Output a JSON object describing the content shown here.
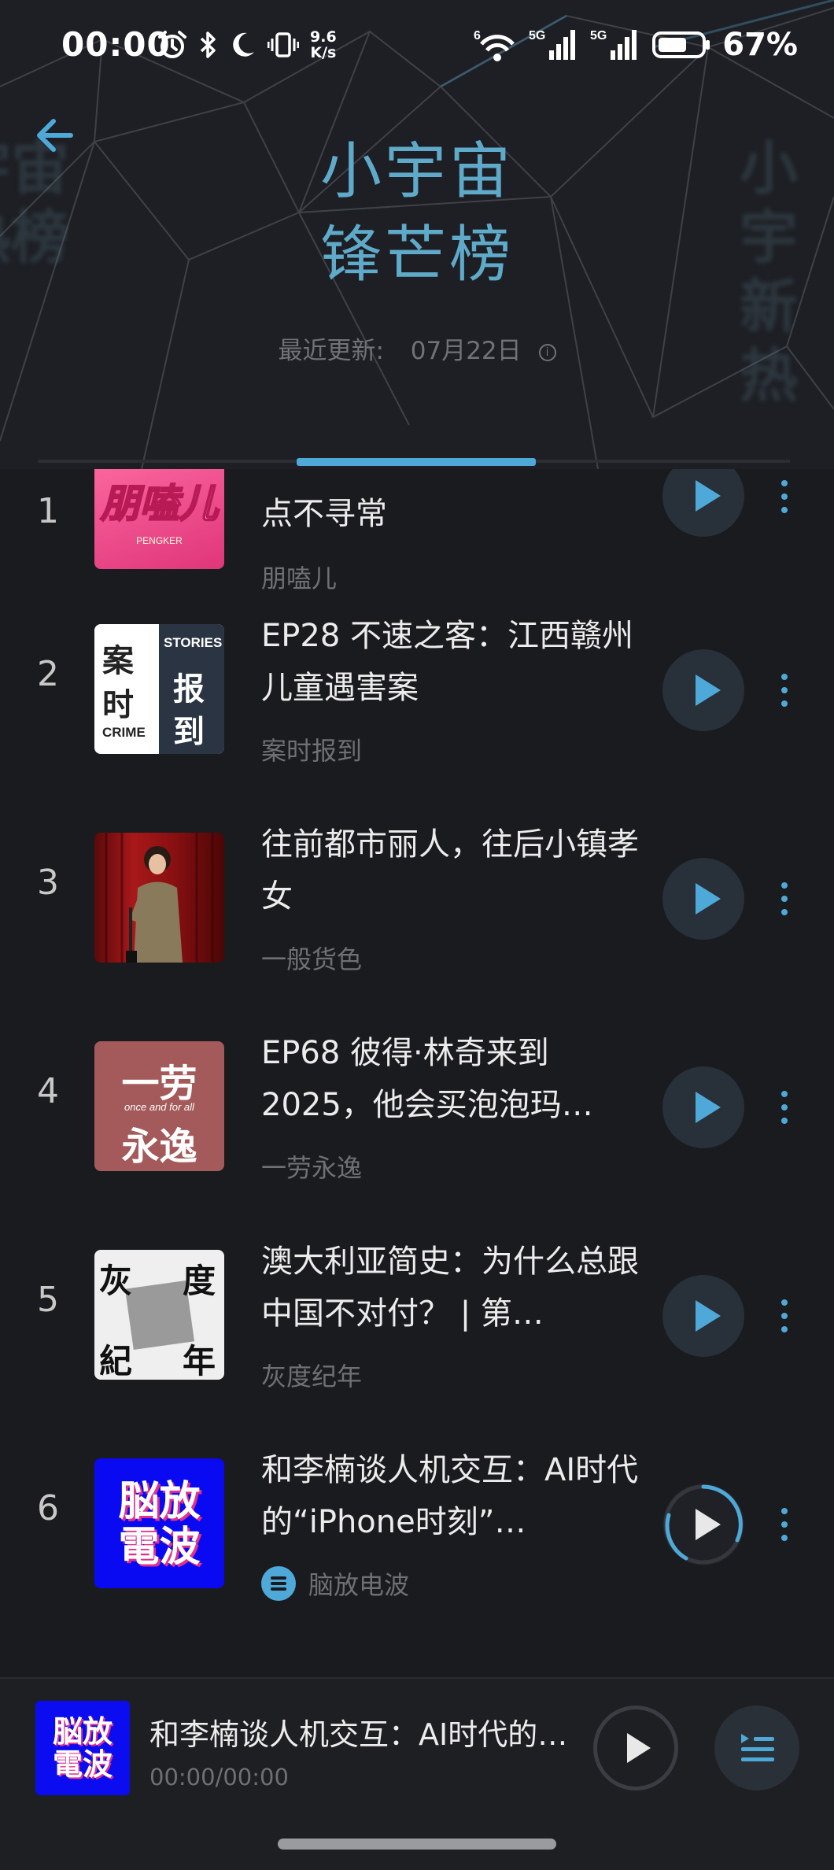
{
  "status": {
    "time": "00:00",
    "net_speed_value": "9.6",
    "net_speed_unit": "K/s",
    "wifi_badge": "6",
    "sim1": "5G",
    "sim2": "5G",
    "battery_pct": "67%",
    "battery_level": 0.67
  },
  "header": {
    "title_line1": "小宇宙",
    "title_line2": "锋芒榜",
    "ghost_left_line1": "宇宙",
    "ghost_left_line2": "热榜",
    "ghost_right_line1": "小宇",
    "ghost_right_line2": "新热",
    "update_label": "最近更新:",
    "update_date": "07月22日",
    "info_glyph": "i"
  },
  "episodes": [
    {
      "rank": "1",
      "title": "点不寻常",
      "author": "朋嗑儿",
      "cover_text": "朋嗑儿",
      "cover_sub": "PENGKER"
    },
    {
      "rank": "2",
      "title": "EP28 不速之客：江西赣州儿童遇害案",
      "author": "案时报到",
      "cover_a": "案",
      "cover_b": "时",
      "cover_c": "CRIME",
      "cover_d": "STORIES",
      "cover_e": "报",
      "cover_f": "到"
    },
    {
      "rank": "3",
      "title": "往前都市丽人，往后小镇孝女",
      "author": "一般货色"
    },
    {
      "rank": "4",
      "title": "EP68 彼得·林奇来到2025，他会买泡泡玛…",
      "author": "一劳永逸",
      "cover_a": "一劳",
      "cover_b": "once and for all",
      "cover_c": "永逸"
    },
    {
      "rank": "5",
      "title": "澳大利亚简史：为什么总跟中国不对付？ | 第…",
      "author": "灰度纪年",
      "cover_a": "灰",
      "cover_b": "度",
      "cover_c": "紀",
      "cover_d": "年"
    },
    {
      "rank": "6",
      "title": "和李楠谈人机交互：AI时代的“iPhone时刻”…",
      "author": "脑放电波",
      "cover_a": "脳放",
      "cover_b": "電波"
    }
  ],
  "player": {
    "title": "和李楠谈人机交互：AI时代的…",
    "time": "00:00/00:00",
    "cover_a": "脳放",
    "cover_b": "電波"
  },
  "colors": {
    "accent": "#4fa9d8",
    "title": "#5fa9c9",
    "background": "#1a1b1f"
  }
}
